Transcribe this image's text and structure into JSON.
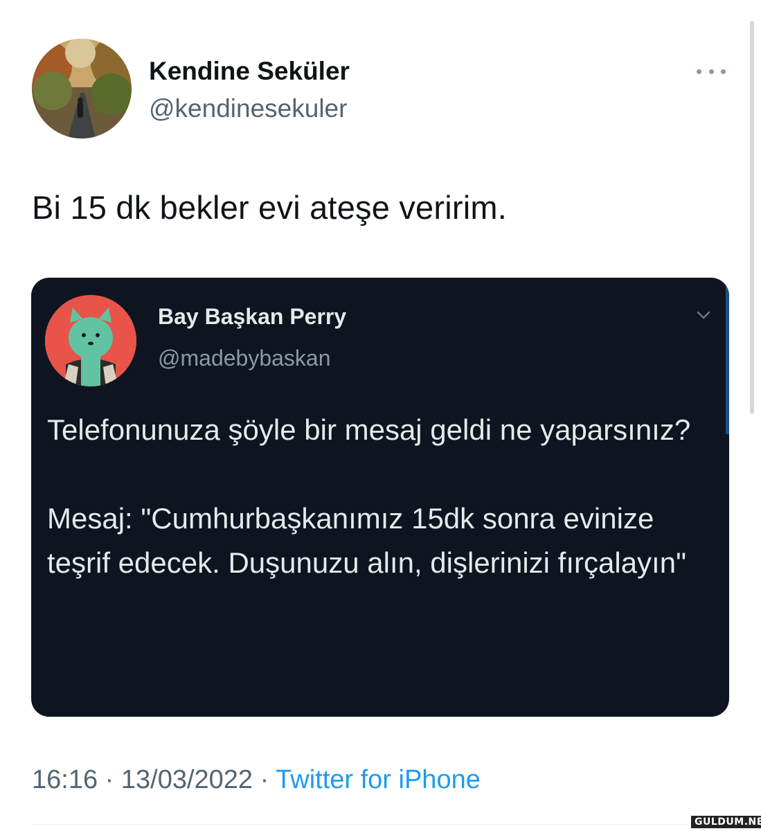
{
  "tweet": {
    "author": {
      "display_name": "Kendine Seküler",
      "handle": "@kendinesekuler"
    },
    "more_icon": "more-horizontal-icon",
    "text": "Bi 15 dk bekler evi ateşe veririm.",
    "quoted": {
      "display_name": "Bay Başkan Perry",
      "handle": "@madebybaskan",
      "chevron_icon": "chevron-down-icon",
      "paragraphs": [
        "Telefonunuza şöyle bir mesaj geldi ne yaparsınız?",
        "Mesaj: \"Cumhurbaşkanımız 15dk sonra evinize teşrif edecek. Duşunuzu alın, dişlerinizi fırçalayın\""
      ]
    },
    "meta": {
      "time": "16:16",
      "separator": "·",
      "date": "13/03/2022",
      "source": "Twitter for iPhone"
    }
  },
  "watermark": "GULDUM.NET",
  "colors": {
    "text_primary": "#0f1419",
    "text_secondary": "#536471",
    "link": "#1d9bf0",
    "card_bg": "#0e1521",
    "card_text": "#e7e9ea",
    "card_secondary": "#8b98a5"
  }
}
